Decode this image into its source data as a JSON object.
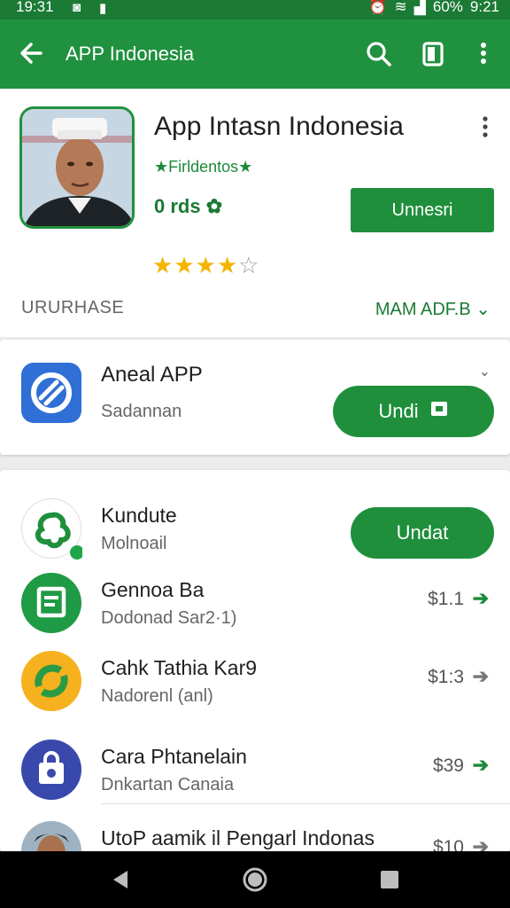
{
  "status": {
    "time": "19:31",
    "battery": "60%",
    "clock_right": "9:21"
  },
  "appbar": {
    "title": "APP Indonesia"
  },
  "hero": {
    "title": "App Intasn Indonesia",
    "developer": "★Firldentos★",
    "meta": "0 rds ✿",
    "install_label": "Unnesri",
    "rating": 4,
    "rating_max": 5,
    "section_left": "URURHASE",
    "section_right": "MAM ADF.B ⌄"
  },
  "featured": {
    "name": "Aneal APP",
    "subtitle": "Sadannan",
    "button_label": "Undi"
  },
  "list": [
    {
      "name": "Kundute",
      "subtitle": "Molnoail",
      "button_label": "Undat",
      "icon": "leaf-icon",
      "color": "#ffffff"
    },
    {
      "name": "Gennoa Ba",
      "subtitle": "Dodonad Sar2·1)",
      "price": "$1.1",
      "icon": "notepad-icon",
      "color": "#1f9a45"
    },
    {
      "name": "Cahk Tathia Kar9",
      "subtitle": "Nadorenl (anl)",
      "price": "$1:3",
      "icon": "sync-icon",
      "color": "#f6b11e"
    },
    {
      "name": "Cara Phtanelain",
      "subtitle": "Dnkartan Canaia",
      "price": "$39",
      "icon": "shopping-bag-icon",
      "color": "#3949ab"
    },
    {
      "name": "UtoP aamik il Pengarl Indonas",
      "subtitle": "",
      "price": "$10",
      "icon": "avatar",
      "color": "#9fb2c2"
    }
  ],
  "colors": {
    "brand": "#20913f",
    "status_bar": "#1b7a34",
    "star": "#f5b400"
  }
}
